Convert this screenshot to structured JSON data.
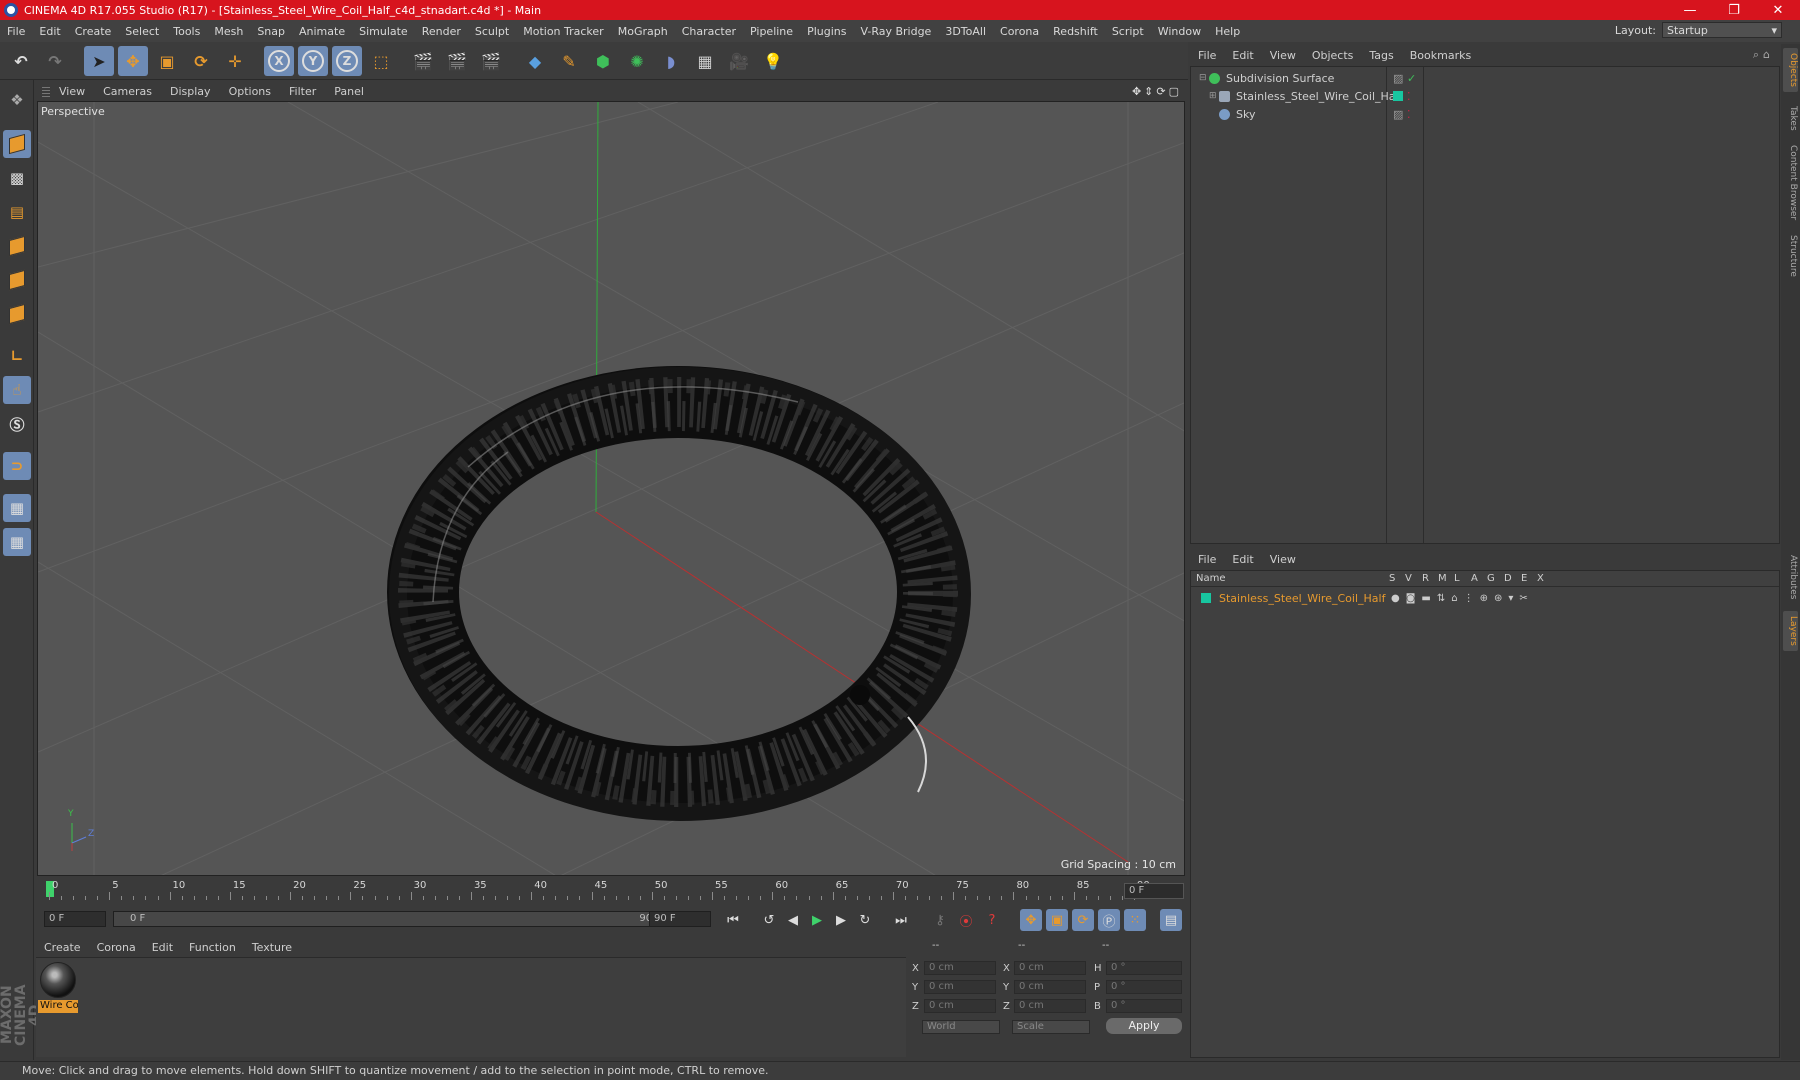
{
  "window": {
    "title": "CINEMA 4D R17.055 Studio (R17) - [Stainless_Steel_Wire_Coil_Half_c4d_stnadart.c4d *] - Main",
    "controls": [
      "—",
      "❐",
      "✕"
    ]
  },
  "menu": [
    "File",
    "Edit",
    "Create",
    "Select",
    "Tools",
    "Mesh",
    "Snap",
    "Animate",
    "Simulate",
    "Render",
    "Sculpt",
    "Motion Tracker",
    "MoGraph",
    "Character",
    "Pipeline",
    "Plugins",
    "V-Ray Bridge",
    "3DToAll",
    "Corona",
    "Redshift",
    "Script",
    "Window",
    "Help"
  ],
  "layout": {
    "label": "Layout:",
    "value": "Startup"
  },
  "toolbar": {
    "axis_x": "X",
    "axis_y": "Y",
    "axis_z": "Z"
  },
  "viewport": {
    "menu": [
      "View",
      "Cameras",
      "Display",
      "Options",
      "Filter",
      "Panel"
    ],
    "label": "Perspective",
    "grid_spacing": "Grid Spacing : 10 cm",
    "axis_labels": {
      "y": "Y",
      "z": "Z"
    }
  },
  "timeline": {
    "ticks": [
      "0",
      "5",
      "10",
      "15",
      "20",
      "25",
      "30",
      "35",
      "40",
      "45",
      "50",
      "55",
      "60",
      "65",
      "70",
      "75",
      "80",
      "85",
      "90"
    ],
    "current_frame": "0 F",
    "start_field": "0 F",
    "range_start": "0 F",
    "range_end": "90 F",
    "end_field": "90 F"
  },
  "material_manager": {
    "menu": [
      "Create",
      "Corona",
      "Edit",
      "Function",
      "Texture"
    ],
    "material_label": "Wire Co"
  },
  "coordinates": {
    "headers": [
      "--",
      "--",
      "--"
    ],
    "rows": [
      {
        "a": "X",
        "av": "0 cm",
        "b": "X",
        "bv": "0 cm",
        "c": "H",
        "cv": "0 °"
      },
      {
        "a": "Y",
        "av": "0 cm",
        "b": "Y",
        "bv": "0 cm",
        "c": "P",
        "cv": "0 °"
      },
      {
        "a": "Z",
        "av": "0 cm",
        "b": "Z",
        "bv": "0 cm",
        "c": "B",
        "cv": "0 °"
      }
    ],
    "mode1": "World",
    "mode2": "Scale",
    "apply": "Apply"
  },
  "object_manager": {
    "menu": [
      "File",
      "Edit",
      "View",
      "Objects",
      "Tags",
      "Bookmarks"
    ],
    "objects": [
      {
        "name": "Subdivision Surface",
        "icon_color": "#3fbf5a"
      },
      {
        "name": "Stainless_Steel_Wire_Coil_Half",
        "icon_color": "#9aa7b8"
      },
      {
        "name": "Sky",
        "icon_color": "#7a9cc6"
      }
    ]
  },
  "layer_manager": {
    "menu": [
      "File",
      "Edit",
      "View"
    ],
    "columns": [
      "Name",
      "S",
      "V",
      "R",
      "M",
      "L",
      "A",
      "G",
      "D",
      "E",
      "X"
    ],
    "layers": [
      {
        "name": "Stainless_Steel_Wire_Coil_Half",
        "color": "#18c6a0"
      }
    ]
  },
  "right_tabs": [
    "Objects",
    "Takes",
    "Content Browser",
    "Structure",
    "Attributes",
    "Layers"
  ],
  "status": "Move: Click and drag to move elements. Hold down SHIFT to quantize movement / add to the selection in point mode, CTRL to remove.",
  "brand": "MAXON CINEMA 4D",
  "colors": {
    "accent": "#e79a2e",
    "highlight": "#6e8bb5",
    "titlebar": "#d7141e"
  }
}
